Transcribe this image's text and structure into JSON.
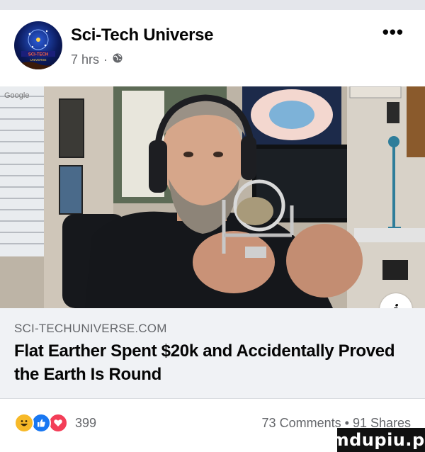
{
  "post": {
    "page_name": "Sci-Tech Universe",
    "time": "7 hrs",
    "privacy_icon": "globe-icon",
    "more_label": "•••"
  },
  "avatar": {
    "text_line1": "SCI-TECH",
    "text_line2": "UNIVERSE"
  },
  "media": {
    "watermark_text": "Google",
    "info_label": "i"
  },
  "link": {
    "domain": "SCI-TECHUNIVERSE.COM",
    "title": "Flat Earther Spent $20k and Accidentally Proved the Earth Is Round"
  },
  "footer": {
    "reactions": [
      "haha",
      "like",
      "love"
    ],
    "reaction_count": "399",
    "comments": "73 Comments",
    "separator": "•",
    "shares": "91 Shares"
  },
  "site_watermark": "mdupiu.pl",
  "colors": {
    "text_primary": "#050505",
    "text_secondary": "#65676b",
    "like_blue": "#1877f2",
    "love_red": "#f33e58",
    "haha_yellow": "#f7b928",
    "link_bg": "#f0f2f5"
  }
}
